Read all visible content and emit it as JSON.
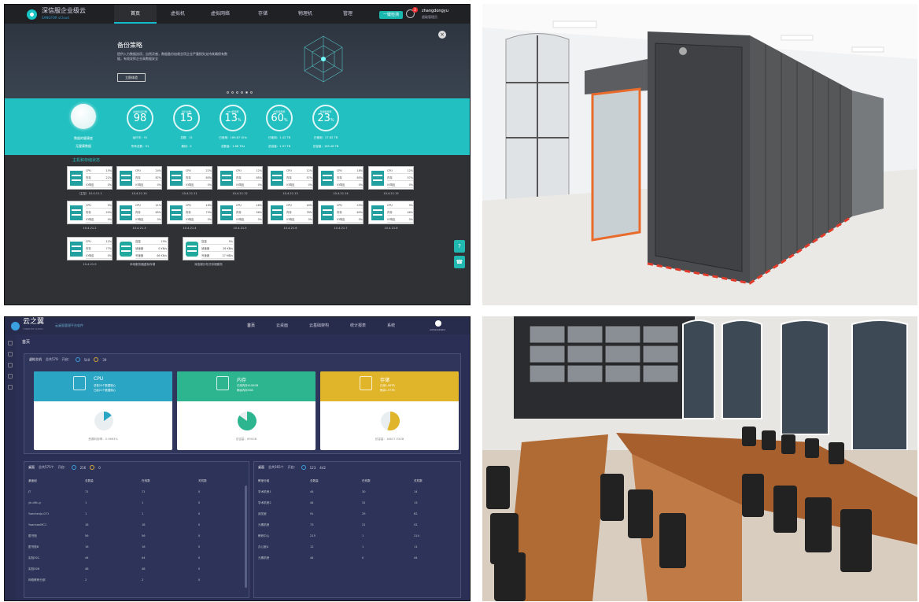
{
  "q1": {
    "brand": "深信服企业级云",
    "brand_sub": "SANGFOR vCloud",
    "nav": [
      "首页",
      "虚拟机",
      "虚拟网络",
      "存储",
      "物理机",
      "管理"
    ],
    "one_click_btn": "一键检测",
    "alert_count": "2",
    "user": "zhangdongyu",
    "user_role": "超级管理员",
    "banner": {
      "title": "备份策略",
      "desc": "提供入力数据选项，自然灵感，数据备份加就业项企业严重损失支持其确保有数据，有效发挥企业高数据安全",
      "button": "立即体验"
    },
    "health_label": "数据的健康度",
    "health_sub": "无健康数据",
    "metrics": [
      {
        "label": "虚拟机运行数",
        "value": "98",
        "unit": "",
        "s1": "运行中：91",
        "s2": "所有总数：91"
      },
      {
        "label": "运行总数",
        "value": "15",
        "unit": "",
        "s1": "总数：15",
        "s2": "离线：0"
      },
      {
        "label": "CPU使用率",
        "value": "13",
        "unit": "%",
        "s1": "已使用：169.87 GHz",
        "s2": "总数量：1.68 THz"
      },
      {
        "label": "内存使用率",
        "value": "60",
        "unit": "%",
        "s1": "已使用：1.42 TB",
        "s2": "总容量：1.97 TB"
      },
      {
        "label": "存储使用率",
        "value": "23",
        "unit": "%",
        "s1": "已使用：27.82 TB",
        "s2": "总容量：165.46 TB"
      }
    ],
    "section_title": "主机和存储状态",
    "hosts_row1": [
      {
        "cpu": "15%",
        "mem": "21%",
        "disk": "0%",
        "name": "（主控）10.4.11.1"
      },
      {
        "cpu": "24%",
        "mem": "87%",
        "disk": "0%",
        "name": "10.4.21.10"
      },
      {
        "cpu": "22%",
        "mem": "65%",
        "disk": "0%",
        "name": "10.4.21.11"
      },
      {
        "cpu": "12%",
        "mem": "65%",
        "disk": "0%",
        "name": "10.4.21.12"
      },
      {
        "cpu": "12%",
        "mem": "57%",
        "disk": "0%",
        "name": "10.4.21.13"
      },
      {
        "cpu": "18%",
        "mem": "65%",
        "disk": "0%",
        "name": "10.4.21.14"
      },
      {
        "cpu": "12%",
        "mem": "57%",
        "disk": "0%",
        "name": "10.4.21.15"
      }
    ],
    "hosts_row2": [
      {
        "cpu": "9%",
        "mem": "20%",
        "disk": "0%",
        "name": "10.4.21.2"
      },
      {
        "cpu": "11%",
        "mem": "65%",
        "disk": "0%",
        "name": "10.4.21.3"
      },
      {
        "cpu": "18%",
        "mem": "79%",
        "disk": "0%",
        "name": "10.4.21.4"
      },
      {
        "cpu": "16%",
        "mem": "56%",
        "disk": "0%",
        "name": "10.4.21.5"
      },
      {
        "cpu": "16%",
        "mem": "78%",
        "disk": "0%",
        "name": "10.4.21.6"
      },
      {
        "cpu": "25%",
        "mem": "69%",
        "disk": "0%",
        "name": "10.4.21.7"
      },
      {
        "cpu": "9%",
        "mem": "46%",
        "disk": "0%",
        "name": "10.4.21.8"
      }
    ],
    "hosts_row3": [
      {
        "cpu": "12%",
        "mem": "77%",
        "disk": "0%",
        "name": "10.4.21.9"
      }
    ],
    "storage": [
      {
        "a_label": "容量",
        "a_val": "19%",
        "b_label": "读速度",
        "b_val": "0 KB/s",
        "c_label": "写速度",
        "c_val": "46 KB/s",
        "name": "本地服务器虚拟存储"
      },
      {
        "a_label": "容量",
        "a_val": "5%",
        "b_label": "读速度",
        "b_val": "26 KB/s",
        "c_label": "写速度",
        "c_val": "27 MB/s",
        "name": "深信服分布式存储服务"
      }
    ],
    "labels": {
      "cpu": "CPU",
      "mem": "内存",
      "disk": "IO响应"
    }
  },
  "q3": {
    "brand": "云之翼",
    "brand_sub": "YUNZHIYI CLOUD",
    "subtitle": "云桌面管理平台软件",
    "nav": [
      "首页",
      "云桌面",
      "云基础架构",
      "统计报表",
      "系统"
    ],
    "user": "administrator",
    "breadcrumb": "首页",
    "panel": {
      "title": "虚拟主机",
      "total": "总共579",
      "running": "开启：",
      "running_count": "540",
      "stopped_count": "39"
    },
    "cards": [
      {
        "title": "CPU",
        "l1": "总核20个数据核心",
        "l2": "已经21个数据核心",
        "footer": "资源利用率：0.9683%",
        "color": "#2aa6c4"
      },
      {
        "title": "内存",
        "l1": "已用内存4100GB",
        "l2": "剩余内存5GB",
        "footer": "总容量：890GB",
        "color": "#2db58f"
      },
      {
        "title": "存储",
        "l1": "已用1.96TB",
        "l2": "剩余1.97TB",
        "footer": "总容量：18627.93GB",
        "color": "#e0b52a"
      }
    ],
    "t1": {
      "title": "桌面",
      "total": "总共575个",
      "on": "开启：",
      "on_count": "256",
      "off_count": "0",
      "headers": [
        "桌面组",
        "总数量",
        "在线数",
        "关机数"
      ],
      "rows": [
        [
          "JT",
          "71",
          "71",
          "0"
        ],
        [
          "yk-dlfc-g",
          "1",
          "1",
          "0"
        ],
        [
          "Yuechenjx-071",
          "1",
          "1",
          "0"
        ],
        [
          "YuanhanMC1",
          "18",
          "18",
          "0"
        ],
        [
          "图书馆",
          "56",
          "56",
          "0"
        ],
        [
          "图书馆B",
          "16",
          "16",
          "0"
        ],
        [
          "实验301",
          "44",
          "44",
          "0"
        ],
        [
          "实验308",
          "48",
          "48",
          "0"
        ],
        [
          "网络教研分部",
          "2",
          "2",
          "0"
        ]
      ]
    },
    "t2": {
      "title": "桌面",
      "total": "总共565个",
      "on": "开启：",
      "on_count": "123",
      "off_count": "442",
      "headers": [
        "教室分组",
        "总数量",
        "在线数",
        "关机数"
      ],
      "rows": [
        [
          "学术机房1",
          "44",
          "30",
          "14"
        ],
        [
          "学术机房2",
          "44",
          "31",
          "13"
        ],
        [
          "阅览室",
          "91",
          "29",
          "62"
        ],
        [
          "元素机房",
          "73",
          "21",
          "52"
        ],
        [
          "教研中心",
          "215",
          "1",
          "214"
        ],
        [
          "办公室A",
          "12",
          "1",
          "11"
        ],
        [
          "元素机房",
          "44",
          "0",
          "44"
        ]
      ]
    }
  }
}
